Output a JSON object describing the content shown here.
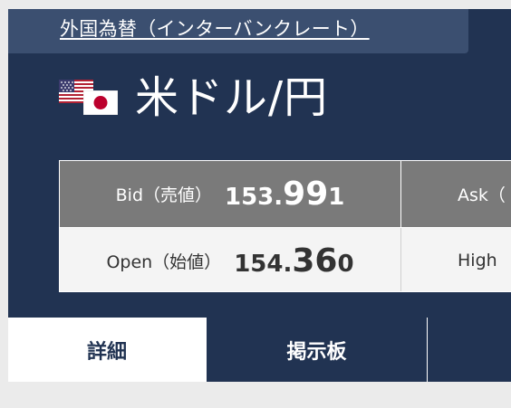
{
  "category": {
    "link_text": "外国為替（インターバンクレート）"
  },
  "pair": {
    "title": "米ドル/円",
    "flags": [
      "us-flag-icon",
      "jp-flag-icon"
    ]
  },
  "quotes": {
    "bid": {
      "label": "Bid（売値）",
      "price_head": "153.",
      "price_big": "99",
      "price_tail": "1"
    },
    "ask": {
      "label": "Ask（"
    },
    "open": {
      "label": "Open（始値）",
      "price_head": "154.",
      "price_big": "36",
      "price_tail": "0"
    },
    "high": {
      "label": "High"
    }
  },
  "tabs": [
    {
      "label": "詳細",
      "active": true
    },
    {
      "label": "掲示板",
      "active": false
    }
  ],
  "colors": {
    "panel": "#213352",
    "category_tab": "#3b4f70",
    "bid_row": "#7a7a7a",
    "open_row": "#f4f4f4",
    "page_background": "#ebebeb"
  }
}
